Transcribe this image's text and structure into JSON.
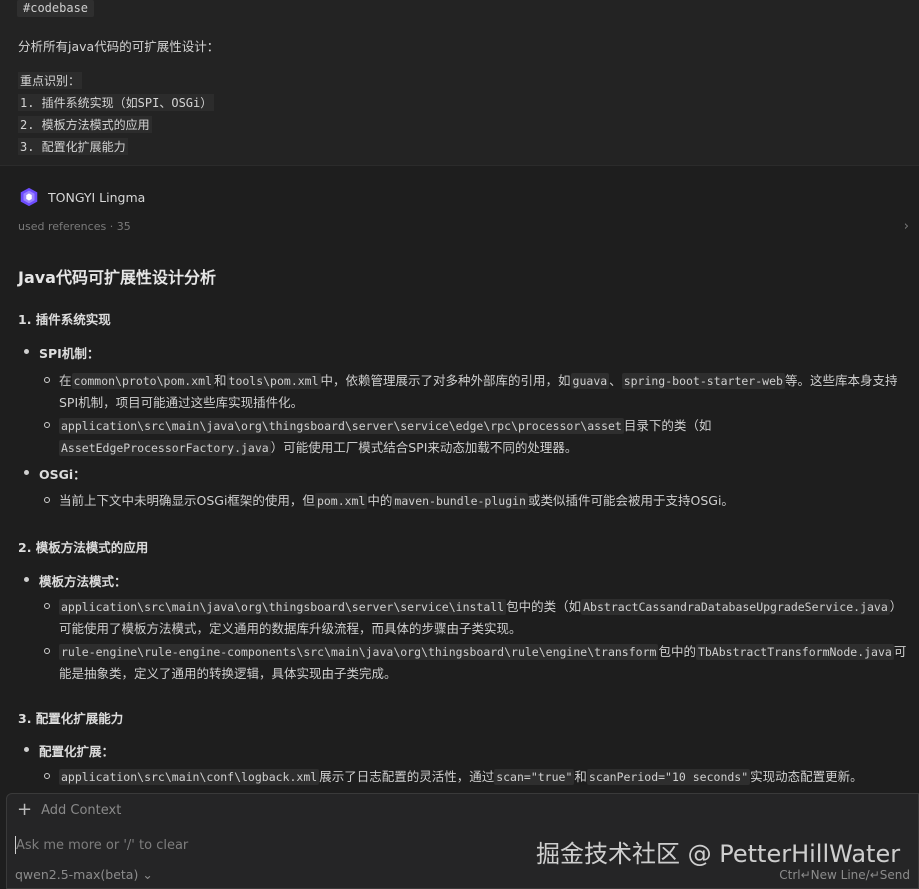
{
  "user_message": {
    "tag": "#codebase",
    "lines": [
      "分析所有java代码的可扩展性设计：",
      "重点识别：",
      "1. 插件系统实现（如SPI、OSGi）",
      "2. 模板方法模式的应用",
      "3. 配置化扩展能力"
    ]
  },
  "assistant": {
    "name": "TONGYI Lingma",
    "refs": "used references · 35",
    "logo_icon": "lingma-logo-icon",
    "accent": "#7c5cff"
  },
  "article": {
    "title": "Java代码可扩展性设计分析",
    "s1": {
      "heading": "1. 插件系统实现",
      "spi_label": "SPI机制：",
      "spi_1": {
        "t1": "在",
        "c1": "common\\proto\\pom.xml",
        "t2": "和",
        "c2": "tools\\pom.xml",
        "t3": "中，依赖管理展示了对多种外部库的引用，如",
        "c3": "guava",
        "t4": "、",
        "c4": "spring-boot-starter-web",
        "t5": "等。这些库本身支持SPI机制，项目可能通过这些库实现插件化。"
      },
      "spi_2": {
        "c1": "application\\src\\main\\java\\org\\thingsboard\\server\\service\\edge\\rpc\\processor\\asset",
        "t1": "目录下的类（如",
        "c2": "AssetEdgeProcessorFactory.java",
        "t2": "）可能使用工厂模式结合SPI来动态加载不同的处理器。"
      },
      "osgi_label": "OSGi：",
      "osgi_1": {
        "t1": "当前上下文中未明确显示OSGi框架的使用，但",
        "c1": "pom.xml",
        "t2": "中的",
        "c2": "maven-bundle-plugin",
        "t3": "或类似插件可能会被用于支持OSGi。"
      }
    },
    "s2": {
      "heading": "2. 模板方法模式的应用",
      "label": "模板方法模式：",
      "b1": {
        "c1": "application\\src\\main\\java\\org\\thingsboard\\server\\service\\install",
        "t1": "包中的类（如",
        "c2": "AbstractCassandraDatabaseUpgradeService.java",
        "t2": "）可能使用了模板方法模式，定义通用的数据库升级流程，而具体的步骤由子类实现。"
      },
      "b2": {
        "c1": "rule-engine\\rule-engine-components\\src\\main\\java\\org\\thingsboard\\rule\\engine\\transform",
        "t1": "包中的",
        "c2": "TbAbstractTransformNode.java",
        "t2": "可能是抽象类，定义了通用的转换逻辑，具体实现由子类完成。"
      }
    },
    "s3": {
      "heading": "3. 配置化扩展能力",
      "label": "配置化扩展：",
      "b1": {
        "c1": "application\\src\\main\\conf\\logback.xml",
        "t1": "展示了日志配置的灵活性，通过",
        "c2": "scan=\"true\"",
        "t2": "和",
        "c3": "scanPeriod=\"10 seconds\"",
        "t3": "实现动态配置更新。"
      }
    }
  },
  "input": {
    "add_context": "Add Context",
    "placeholder": "Ask me more or '/' to clear",
    "model": "qwen2.5-max(beta)",
    "shortcut": "Ctrl↵New Line/↵Send"
  },
  "watermark": "掘金技术社区 @ PetterHillWater"
}
